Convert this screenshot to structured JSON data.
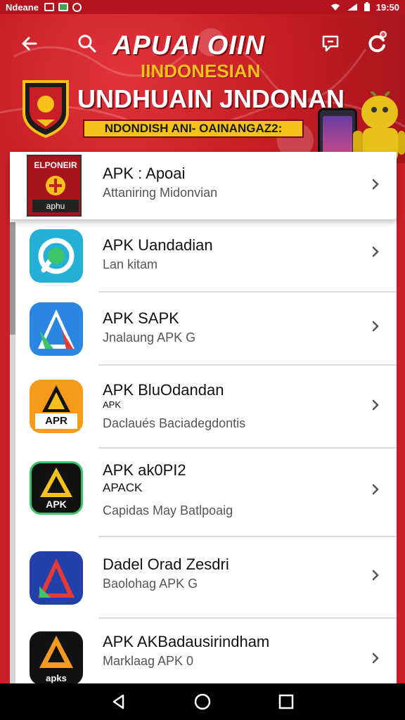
{
  "status_bar": {
    "carrier": "Ndeane",
    "time": "19:50"
  },
  "header": {
    "brand_title": "APUAI OIIN",
    "brand_subtitle": "IINDONESIAN",
    "heading": "UNDHUAIN JNDONAN",
    "ribbon": "NDONDISH ANI- OAINANGAZ2:"
  },
  "apps": [
    {
      "name": "APK : Apoai",
      "desc": "Attaniring Midonvian",
      "icon": "featured-app-icon",
      "icon_label_top": "ELPONEIR",
      "icon_label_bottom": "aphu",
      "accent": "#c81e26"
    },
    {
      "name": "APK Uandadian",
      "desc": "Lan kitam",
      "icon": "chat-bubble-app-icon",
      "accent": "#1fa3c8"
    },
    {
      "name": "APK SAPK",
      "desc": "Jnalaung APK G",
      "icon": "triangle-app-icon",
      "accent": "#2a86e0"
    },
    {
      "name": "APK BluOdandan",
      "tag": "APK",
      "desc": "Daclaués Baciadegdontis",
      "icon": "apr-app-icon",
      "icon_text": "APR",
      "accent": "#f59a1a"
    },
    {
      "name": "APK ak0PI2",
      "tag": "APACK",
      "desc": "Capidas May Batlpoaig",
      "icon": "apk-black-app-icon",
      "icon_text": "APK",
      "accent": "#111111"
    },
    {
      "name": "Dadel Orad Zesdri",
      "desc": "Baolohag APK G",
      "icon": "blue-red-app-icon",
      "accent": "#2140a8"
    },
    {
      "name": "APK AKBadausirindham",
      "desc": "Marklaag APK 0",
      "icon": "apks-app-icon",
      "icon_text": "apks",
      "accent": "#111111"
    }
  ]
}
